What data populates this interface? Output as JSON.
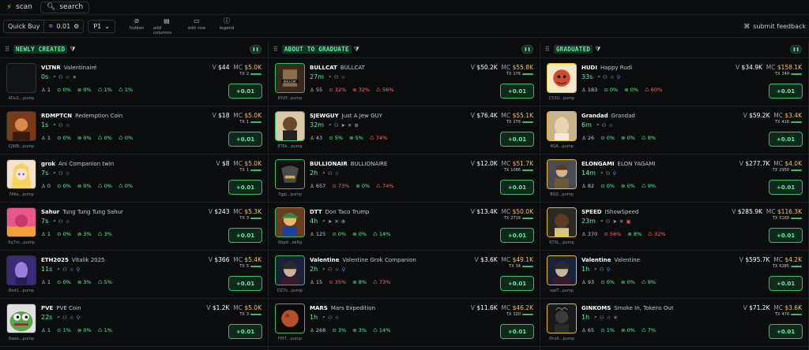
{
  "topbar": {
    "brand": "scan",
    "search": "search"
  },
  "toolbar": {
    "quick_buy": "Quick Buy",
    "amount": "0.01",
    "preset": "P1",
    "tools": [
      {
        "icon": "eye-off-icon",
        "glyph": "⊘",
        "label": "hidden"
      },
      {
        "icon": "columns-icon",
        "glyph": "▤",
        "label": "add columns"
      },
      {
        "icon": "edit-row-icon",
        "glyph": "▭",
        "label": "edit row"
      },
      {
        "icon": "info-icon",
        "glyph": "ⓘ",
        "label": "legend"
      }
    ],
    "feedback": "submit feedback"
  },
  "colors": {
    "accent": "#5df2a2",
    "mc": "#f0c64a",
    "danger": "#ff6b6b",
    "border_green": "#2fbf6a",
    "border_yellow": "#e8c21e"
  },
  "buy_label": "+0.01",
  "columns": [
    {
      "title": "NEWLY CREATED",
      "rows": [
        {
          "ticker": "VLTNR",
          "name": "Valentinairé",
          "age": "0s",
          "icons": [
            "search",
            "person",
            "star",
            "x"
          ],
          "v": "$44",
          "mc": "$5.0K",
          "tx": "2",
          "addr": "ADu1...pump",
          "stats": [
            "1",
            "0%",
            "0%",
            "1%",
            "1%"
          ],
          "neg": [
            false,
            false,
            false,
            false,
            false
          ],
          "border": "n",
          "pic": "none"
        },
        {
          "ticker": "RDMPTCN",
          "name": "Redemption Coin",
          "age": "1s",
          "icons": [
            "search",
            "person",
            "star"
          ],
          "v": "$18",
          "mc": "$5.0K",
          "tx": "1",
          "addr": "CJWB...pump",
          "stats": [
            "1",
            "0%",
            "0%",
            "0%",
            "0%"
          ],
          "neg": [
            false,
            false,
            false,
            false,
            false
          ],
          "border": "n",
          "pic": "warm"
        },
        {
          "ticker": "grok",
          "name": "Ani Companion twin",
          "age": "7s",
          "icons": [
            "search",
            "person",
            "star"
          ],
          "v": "$8",
          "mc": "$5.0K",
          "tx": "1",
          "addr": "7AKe...pump",
          "stats": [
            "0",
            "0%",
            "0%",
            "0%",
            "0%"
          ],
          "neg": [
            false,
            false,
            false,
            false,
            false
          ],
          "border": "n",
          "pic": "anime"
        },
        {
          "ticker": "Sahur",
          "name": "Tung Tung Tung Sahur",
          "age": "7s",
          "icons": [
            "search",
            "person",
            "star"
          ],
          "v": "$243",
          "mc": "$5.3K",
          "tx": "3",
          "addr": "5q7m...pump",
          "stats": [
            "1",
            "0%",
            "3%",
            "3%"
          ],
          "neg": [
            false,
            false,
            false,
            false
          ],
          "border": "n",
          "pic": "pink"
        },
        {
          "ticker": "ETH2025",
          "name": "Vitalik 2025",
          "age": "11s",
          "icons": [
            "search",
            "person",
            "star",
            "blue"
          ],
          "v": "$366",
          "mc": "$5.4K",
          "tx": "5",
          "addr": "Bod1...pump",
          "stats": [
            "1",
            "0%",
            "3%",
            "5%"
          ],
          "neg": [
            false,
            false,
            false,
            false
          ],
          "border": "n",
          "pic": "purple"
        },
        {
          "ticker": "PVE",
          "name": "PVE Coin",
          "age": "22s",
          "icons": [
            "search",
            "person",
            "star",
            "blue"
          ],
          "v": "$1.2K",
          "mc": "$5.0K",
          "tx": "3",
          "addr": "8wez...pump",
          "stats": [
            "1",
            "1%",
            "0%",
            "1%"
          ],
          "neg": [
            false,
            false,
            false,
            false
          ],
          "border": "n",
          "pic": "pepe"
        }
      ]
    },
    {
      "title": "ABOUT TO GRADUATE",
      "rows": [
        {
          "ticker": "BULLCAT",
          "name": "BULLCAT",
          "age": "27m",
          "icons": [
            "search",
            "person",
            "star"
          ],
          "v": "$50.2K",
          "mc": "$55.8K",
          "tx": "176",
          "addr": "6YdY...pump",
          "stats": [
            "55",
            "32%",
            "32%",
            "56%"
          ],
          "neg": [
            false,
            true,
            true,
            true
          ],
          "border": "g",
          "pic": "bullcat"
        },
        {
          "ticker": "SJEWGUY",
          "name": "Just A Jew GUY",
          "age": "32m",
          "icons": [
            "search",
            "person",
            "send",
            "x",
            "globe"
          ],
          "v": "$76.4K",
          "mc": "$55.1K",
          "tx": "276",
          "addr": "8T6k...pump",
          "stats": [
            "43",
            "5%",
            "5%",
            "74%"
          ],
          "neg": [
            false,
            false,
            false,
            true
          ],
          "border": "g",
          "pic": "bear"
        },
        {
          "ticker": "BULLIONAIR",
          "name": "BULLIONAIRE",
          "age": "2h",
          "icons": [
            "search",
            "person",
            "star"
          ],
          "v": "$12.0K",
          "mc": "$51.7K",
          "tx": "1086",
          "addr": "7gpJ...pump",
          "stats": [
            "657",
            "73%",
            "0%",
            "74%"
          ],
          "neg": [
            false,
            true,
            false,
            true
          ],
          "border": "g",
          "pic": "bull"
        },
        {
          "ticker": "DTT",
          "name": "Don Taco Trump",
          "age": "4h",
          "icons": [
            "search",
            "send",
            "x",
            "globe"
          ],
          "v": "$13.4K",
          "mc": "$50.0K",
          "tx": "2719",
          "addr": "6bpd...ek6g",
          "stats": [
            "125",
            "0%",
            "0%",
            "14%"
          ],
          "neg": [
            false,
            false,
            false,
            false
          ],
          "border": "g",
          "pic": "trump"
        },
        {
          "ticker": "Valentine",
          "name": "Valentine Grok Companion",
          "age": "2h",
          "icons": [
            "search",
            "person",
            "star",
            "blue"
          ],
          "v": "$3.6K",
          "mc": "$49.1K",
          "tx": "34",
          "addr": "DZ7s...pump",
          "stats": [
            "15",
            "35%",
            "8%",
            "73%"
          ],
          "neg": [
            false,
            true,
            false,
            true
          ],
          "border": "g",
          "pic": "dark"
        },
        {
          "ticker": "MARS",
          "name": "Mars Expedition",
          "age": "1h",
          "icons": [
            "search",
            "person",
            "star"
          ],
          "v": "$11.6K",
          "mc": "$46.2K",
          "tx": "320",
          "addr": "FPf7...pump",
          "stats": [
            "268",
            "3%",
            "3%",
            "14%"
          ],
          "neg": [
            false,
            false,
            false,
            false
          ],
          "border": "g",
          "pic": "mars"
        }
      ]
    },
    {
      "title": "GRADUATED",
      "rows": [
        {
          "ticker": "HUDI",
          "name": "Happy Rudi",
          "age": "33s",
          "icons": [
            "search",
            "person",
            "star",
            "blue"
          ],
          "v": "$34.9K",
          "mc": "$158.1K",
          "tx": "240",
          "addr": "C53U...pump",
          "stats": [
            "183",
            "0%",
            "0%",
            "60%"
          ],
          "neg": [
            false,
            false,
            false,
            true
          ],
          "border": "y",
          "pic": "rudi"
        },
        {
          "ticker": "Grandad",
          "name": "Grandad",
          "age": "6m",
          "icons": [
            "search",
            "person",
            "star"
          ],
          "v": "$59.2K",
          "mc": "$3.4K",
          "tx": "416",
          "addr": "4GA...pump",
          "stats": [
            "26",
            "0%",
            "0%",
            "8%"
          ],
          "neg": [
            false,
            false,
            false,
            false
          ],
          "border": "y",
          "pic": "grandad"
        },
        {
          "ticker": "ELONGAMI",
          "name": "ELON YAGAMI",
          "age": "14m",
          "icons": [
            "search",
            "person",
            "blue"
          ],
          "v": "$277.7K",
          "mc": "$4.0K",
          "tx": "2950",
          "addr": "BSQ...pump",
          "stats": [
            "82",
            "0%",
            "0%",
            "9%"
          ],
          "neg": [
            false,
            false,
            false,
            false
          ],
          "border": "y",
          "pic": "elon"
        },
        {
          "ticker": "SPEED",
          "name": "IShowSpeed",
          "age": "23m",
          "icons": [
            "search",
            "person",
            "send",
            "x",
            "red"
          ],
          "v": "$285.9K",
          "mc": "$116.3K",
          "tx": "5169",
          "addr": "670L...pump",
          "stats": [
            "370",
            "56%",
            "8%",
            "32%"
          ],
          "neg": [
            false,
            true,
            false,
            true
          ],
          "border": "y",
          "pic": "speed"
        },
        {
          "ticker": "Valentine",
          "name": "Valentine",
          "age": "1h",
          "icons": [
            "search",
            "person",
            "blue"
          ],
          "v": "$595.7K",
          "mc": "$4.2K",
          "tx": "6285",
          "addr": "sqsT...pump",
          "stats": [
            "93",
            "0%",
            "0%",
            "9%"
          ],
          "neg": [
            false,
            false,
            false,
            false
          ],
          "border": "y",
          "pic": "dark"
        },
        {
          "ticker": "GINKOMS",
          "name": "Smoke In, Tokens Out",
          "age": "1h",
          "icons": [
            "search",
            "person",
            "star",
            "x"
          ],
          "v": "$71.2K",
          "mc": "$3.6K",
          "tx": "476",
          "addr": "0ho6...pump",
          "stats": [
            "65",
            "1%",
            "0%",
            "7%"
          ],
          "neg": [
            false,
            false,
            false,
            false
          ],
          "border": "y",
          "pic": "smoke"
        }
      ]
    }
  ]
}
